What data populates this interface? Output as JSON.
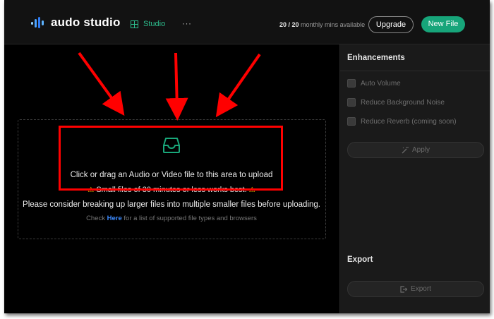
{
  "header": {
    "logo_text": "audo studio",
    "nav_studio": "Studio",
    "nav_more": "···",
    "mins_count": "20 / 20",
    "mins_label": "monthly mins available",
    "upgrade_label": "Upgrade",
    "new_file_label": "New File"
  },
  "upload": {
    "main_text": "Click or drag an Audio or Video file to this area to upload",
    "small_files_text": "Small files of 30 minutes or less works best.",
    "consider_text": "Please consider breaking up larger files into multiple smaller files before uploading.",
    "check_prefix": "Check",
    "check_link": "Here",
    "check_suffix": "for a list of supported file types and browsers"
  },
  "sidebar": {
    "enhancements_title": "Enhancements",
    "options": [
      "Auto Volume",
      "Reduce Background Noise",
      "Reduce Reverb (coming soon)"
    ],
    "apply_label": "Apply",
    "export_title": "Export",
    "export_label": "Export"
  },
  "colors": {
    "accent": "#17a57a",
    "studio_green": "#2dbf8e",
    "link_blue": "#3d8bff",
    "annotation_red": "#ff0000",
    "warning_yellow": "#f2c200"
  },
  "icons": {
    "logo": "waveform-icon",
    "studio": "grid-icon",
    "upload": "inbox-icon",
    "warning": "warning-icon",
    "apply": "magic-wand-icon",
    "export": "export-icon"
  }
}
